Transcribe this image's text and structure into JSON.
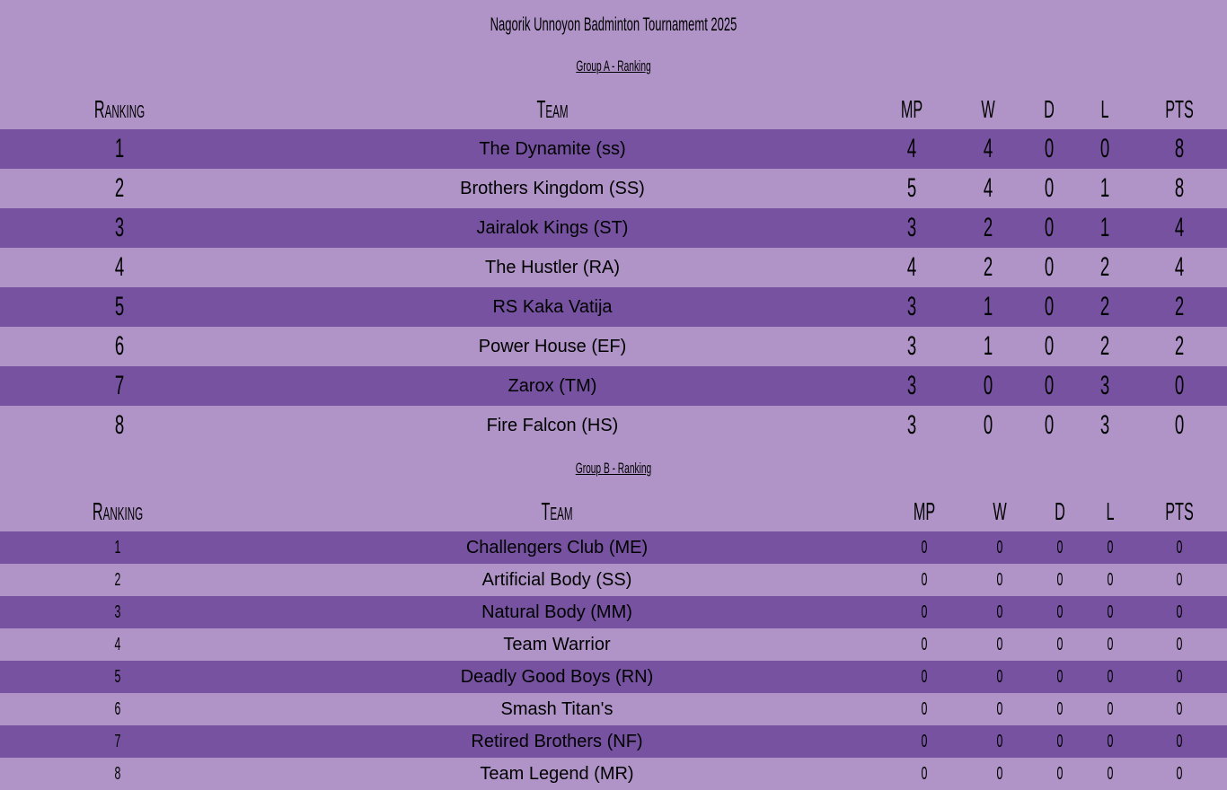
{
  "title": "Nagorik Unnoyon Badminton Tournamemt 2025",
  "headers": {
    "ranking": "Ranking",
    "team": "Team",
    "mp": "MP",
    "w": "W",
    "d": "D",
    "l": "L",
    "pts": "PTS"
  },
  "groups": [
    {
      "title": "Group A - Ranking",
      "rows": [
        {
          "rank": "1",
          "team": "The Dynamite (ss)",
          "mp": "4",
          "w": "4",
          "d": "0",
          "l": "0",
          "pts": "8"
        },
        {
          "rank": "2",
          "team": "Brothers Kingdom (SS)",
          "mp": "5",
          "w": "4",
          "d": "0",
          "l": "1",
          "pts": "8"
        },
        {
          "rank": "3",
          "team": "Jairalok Kings (ST)",
          "mp": "3",
          "w": "2",
          "d": "0",
          "l": "1",
          "pts": "4"
        },
        {
          "rank": "4",
          "team": "The Hustler (RA)",
          "mp": "4",
          "w": "2",
          "d": "0",
          "l": "2",
          "pts": "4"
        },
        {
          "rank": "5",
          "team": "RS Kaka Vatija",
          "mp": "3",
          "w": "1",
          "d": "0",
          "l": "2",
          "pts": "2"
        },
        {
          "rank": "6",
          "team": "Power House (EF)",
          "mp": "3",
          "w": "1",
          "d": "0",
          "l": "2",
          "pts": "2"
        },
        {
          "rank": "7",
          "team": "Zarox (TM)",
          "mp": "3",
          "w": "0",
          "d": "0",
          "l": "3",
          "pts": "0"
        },
        {
          "rank": "8",
          "team": "Fire Falcon (HS)",
          "mp": "3",
          "w": "0",
          "d": "0",
          "l": "3",
          "pts": "0"
        }
      ]
    },
    {
      "title": "Group B - Ranking",
      "rows": [
        {
          "rank": "1",
          "team": "Challengers Club (ME)",
          "mp": "0",
          "w": "0",
          "d": "0",
          "l": "0",
          "pts": "0"
        },
        {
          "rank": "2",
          "team": "Artificial Body (SS)",
          "mp": "0",
          "w": "0",
          "d": "0",
          "l": "0",
          "pts": "0"
        },
        {
          "rank": "3",
          "team": "Natural Body (MM)",
          "mp": "0",
          "w": "0",
          "d": "0",
          "l": "0",
          "pts": "0"
        },
        {
          "rank": "4",
          "team": "Team Warrior",
          "mp": "0",
          "w": "0",
          "d": "0",
          "l": "0",
          "pts": "0"
        },
        {
          "rank": "5",
          "team": "Deadly Good Boys (RN)",
          "mp": "0",
          "w": "0",
          "d": "0",
          "l": "0",
          "pts": "0"
        },
        {
          "rank": "6",
          "team": "Smash Titan's",
          "mp": "0",
          "w": "0",
          "d": "0",
          "l": "0",
          "pts": "0"
        },
        {
          "rank": "7",
          "team": "Retired Brothers (NF)",
          "mp": "0",
          "w": "0",
          "d": "0",
          "l": "0",
          "pts": "0"
        },
        {
          "rank": "8",
          "team": "Team Legend (MR)",
          "mp": "0",
          "w": "0",
          "d": "0",
          "l": "0",
          "pts": "0"
        }
      ]
    }
  ],
  "colors": {
    "background": "#b094c8",
    "row_dark": "#7652a1"
  }
}
